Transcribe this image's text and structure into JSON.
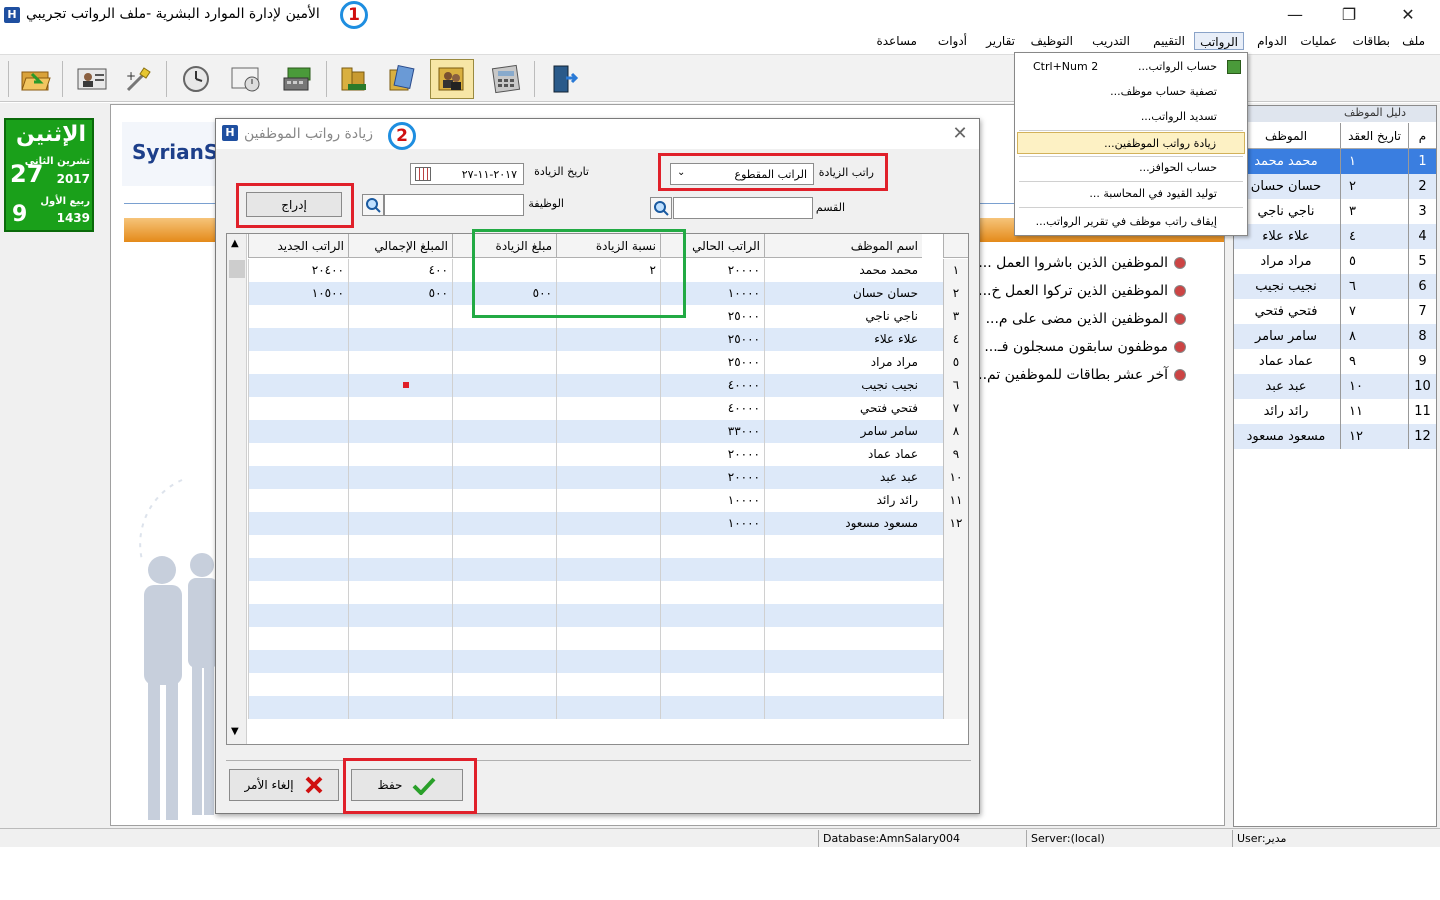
{
  "window": {
    "title": "الأمين لإدارة الموارد البشرية -ملف الرواتب تجريبي",
    "badge1": "1",
    "minimize": "—",
    "maximize": "❐",
    "close": "✕"
  },
  "menubar": [
    "ملف",
    "بطاقات",
    "عمليات",
    "الدوام",
    "الرواتب",
    "التقييم",
    "التدريب",
    "التوظيف",
    "تقارير",
    "أدوات",
    "مساعدة"
  ],
  "dropdown": {
    "items": [
      {
        "label": "حساب الرواتب...",
        "shortcut": "Ctrl+Num 2"
      },
      {
        "label": "تصفية حساب موظف..."
      },
      {
        "label": "تسديد الرواتب..."
      },
      {
        "label": "زيادة رواتب الموظفين..."
      },
      {
        "label": "حساب الحوافز..."
      },
      {
        "label": "توليد القيود في المحاسبة ..."
      },
      {
        "label": "إيقاف راتب موظف في تقرير الرواتب..."
      }
    ]
  },
  "calendar": {
    "weekday": "الإثنين",
    "greg_day": "27",
    "greg_month": "تشرين الثاني",
    "greg_year": "2017",
    "hijri_day": "9",
    "hijri_month": "ربيع الأول",
    "hijri_year": "1439"
  },
  "logo": {
    "text": "SyrianSo"
  },
  "quick_links": [
    "الموظفين الذين باشروا العمل ...",
    "الموظفين الذين تركوا العمل خ...",
    "الموظفين الذين مضى على م...",
    "موظفون سابقون مسجلون فـ...",
    "آخر عشر بطاقات للموظفين تم..."
  ],
  "guide": {
    "title": "دليل الموظف",
    "close": "✕",
    "col_no": "م",
    "col_date": "تاريخ العقد",
    "col_name": "الموظف",
    "rows": [
      {
        "no": "1",
        "date": "١",
        "name": "محمد محمد"
      },
      {
        "no": "2",
        "date": "٢",
        "name": "حسان حسان"
      },
      {
        "no": "3",
        "date": "٣",
        "name": "ناجي ناجي"
      },
      {
        "no": "4",
        "date": "٤",
        "name": "علاء علاء"
      },
      {
        "no": "5",
        "date": "٥",
        "name": "مراد مراد"
      },
      {
        "no": "6",
        "date": "٦",
        "name": "نجيب نجيب"
      },
      {
        "no": "7",
        "date": "٧",
        "name": "فتحي فتحي"
      },
      {
        "no": "8",
        "date": "٨",
        "name": "سامر سامر"
      },
      {
        "no": "9",
        "date": "٩",
        "name": "عماد عماد"
      },
      {
        "no": "10",
        "date": "١٠",
        "name": "عبد عبد"
      },
      {
        "no": "11",
        "date": "١١",
        "name": "رائد رائد"
      },
      {
        "no": "12",
        "date": "١٢",
        "name": "مسعود مسعود"
      }
    ]
  },
  "status": {
    "database": "Database:AmnSalary004",
    "server": "Server:(local)",
    "user": "User:مدير"
  },
  "dialog": {
    "title": "زيادة رواتب الموظفين",
    "badge2": "2",
    "close": "✕",
    "raise_salary_label": "راتب الزيادة",
    "raise_salary_value": "الراتب المقطوع",
    "raise_date_label": "تاريخ الزيادة",
    "raise_date_value": "٢٠١٧-١١-٢٧",
    "dept_label": "القسم",
    "job_label": "الوظيفة",
    "insert_button": "إدراج",
    "save_button": "حفظ",
    "cancel_button": "إلغاء الأمر",
    "columns": [
      "اسم الموظف",
      "الراتب الحالي",
      "نسبة الزيادة",
      "مبلغ الزيادة",
      "المبلغ الإجمالي",
      "الراتب الجديد"
    ],
    "rows": [
      {
        "no": "١",
        "name": "محمد محمد",
        "current": "٢٠٠٠٠",
        "pct": "٢",
        "amount": "",
        "total": "٤٠٠",
        "new": "٢٠٤٠٠"
      },
      {
        "no": "٢",
        "name": "حسان حسان",
        "current": "١٠٠٠٠",
        "pct": "",
        "amount": "٥٠٠",
        "total": "٥٠٠",
        "new": "١٠٥٠٠"
      },
      {
        "no": "٣",
        "name": "ناجي ناجي",
        "current": "٢٥٠٠٠",
        "pct": "",
        "amount": "",
        "total": "",
        "new": ""
      },
      {
        "no": "٤",
        "name": "علاء علاء",
        "current": "٢٥٠٠٠",
        "pct": "",
        "amount": "",
        "total": "",
        "new": ""
      },
      {
        "no": "٥",
        "name": "مراد مراد",
        "current": "٢٥٠٠٠",
        "pct": "",
        "amount": "",
        "total": "",
        "new": ""
      },
      {
        "no": "٦",
        "name": "نجيب نجيب",
        "current": "٤٠٠٠٠",
        "pct": "",
        "amount": "",
        "total": "",
        "new": ""
      },
      {
        "no": "٧",
        "name": "فتحي فتحي",
        "current": "٤٠٠٠٠",
        "pct": "",
        "amount": "",
        "total": "",
        "new": ""
      },
      {
        "no": "٨",
        "name": "سامر سامر",
        "current": "٣٣٠٠٠",
        "pct": "",
        "amount": "",
        "total": "",
        "new": ""
      },
      {
        "no": "٩",
        "name": "عماد عماد",
        "current": "٢٠٠٠٠",
        "pct": "",
        "amount": "",
        "total": "",
        "new": ""
      },
      {
        "no": "١٠",
        "name": "عبد عبد",
        "current": "٢٠٠٠٠",
        "pct": "",
        "amount": "",
        "total": "",
        "new": ""
      },
      {
        "no": "١١",
        "name": "رائد رائد",
        "current": "١٠٠٠٠",
        "pct": "",
        "amount": "",
        "total": "",
        "new": ""
      },
      {
        "no": "١٢",
        "name": "مسعود مسعود",
        "current": "١٠٠٠٠",
        "pct": "",
        "amount": "",
        "total": "",
        "new": ""
      }
    ]
  },
  "colors": {
    "highlight_red": "#e0202a",
    "highlight_green": "#22aa44",
    "selection_blue": "#3a7ee0",
    "calendar_green": "#1aa01a"
  },
  "icons": [
    "folder-open-icon",
    "id-card-icon",
    "wand-icon",
    "clock-icon",
    "schedule-icon",
    "money-icon",
    "books-icon",
    "documents-icon",
    "employees-icon",
    "calculator-icon",
    "exit-icon",
    "search-icon",
    "calendar-icon",
    "check-icon",
    "cross-icon"
  ]
}
